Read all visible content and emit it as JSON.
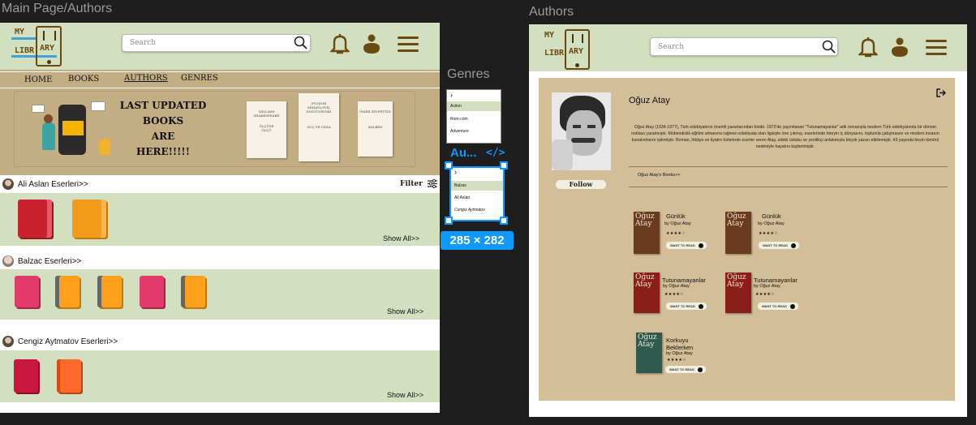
{
  "canvas": {
    "frame1_title": "Main Page/Authors",
    "frame2_title": "Authors",
    "component_title": "Genres",
    "component2_title": "Au...",
    "selection_size": "285 × 282",
    "code_icon_glyph": "</>"
  },
  "logo": {
    "line1": "MY",
    "line2": "LIBR",
    "line3": "ARY"
  },
  "header": {
    "search_placeholder": "Search"
  },
  "main": {
    "nav": [
      "HOME",
      "BOOKS",
      "AUTHORS",
      "GENRES"
    ],
    "banner_lines": [
      "LAST UPDATED",
      "BOOKS",
      "ARE",
      "HERE!!!!!"
    ],
    "banner_books": [
      {
        "lines": [
          "WILLIAM",
          "SHAKESPEARE",
          "",
          "",
          "",
          "",
          "",
          "",
          "",
          "",
          "",
          "ÖLÇÜYE",
          "ÖLÇÜ"
        ]
      },
      {
        "lines": [
          "FYODOR",
          "MİHAYLOVİÇ",
          "DOSTOYEVSKİ",
          "",
          "",
          "",
          "",
          "",
          "",
          "",
          "",
          "SUÇ VE CEZA"
        ]
      },
      {
        "lines": [
          "ÖMER SEYFETTİN",
          "",
          "",
          "",
          "",
          "",
          "",
          "",
          "",
          "",
          "",
          "KALBİM"
        ]
      }
    ],
    "sections": [
      {
        "label": "Ali Aslan Eserleri>>",
        "show_all": "Show All>>"
      },
      {
        "label": "Balzac  Eserleri>>",
        "show_all": "Show All>>"
      },
      {
        "label": "Cengiz Aytmatov Eserleri>>",
        "show_all": "Show All>>"
      }
    ],
    "filter_label": "Filter"
  },
  "genres": {
    "items": [
      "Action",
      "Rom-com",
      "Adventure"
    ],
    "items2": [
      "Balzac",
      "Ali Aslan",
      "Cengiz Aytmatov"
    ]
  },
  "author": {
    "name": "Oğuz Atay",
    "bio": "Oğuz Atay (1934-1977), Türk edebiyatının önemli yazarlarından biridir. 1972'de yayımlanan \"Tutunamayanlar\" adlı romanıyla modern Türk edebiyatında bir dönüm noktası yaratmıştır. Mühendislik eğitimi almasına rağmen edebiyata olan ilgisiyle öne çıkmış, eserlerinde bireyin iç dünyasını, toplumla çatışmasını ve modern insanın bunalımlarını işlemiştir. Roman, hikâye ve tiyatro türlerinde eserler veren Atay, edebi üslubu ve yenilikçi anlatımıyla birçok yazarı etkilemiştir. 43 yaşında beyin tümörü nedeniyle hayatını kaybetmiştir.",
    "follow_label": "Follow",
    "books_link": "Oğuz Atay's Books>>",
    "books": [
      {
        "title": "Günlük",
        "by": "by Oğuz Atay",
        "stars": "★★★★☆",
        "cta": "WANT TO READ",
        "cover_author": "Oğuz Atay",
        "cover_title": "Günlük",
        "color": "#6b3b1f"
      },
      {
        "title": "Günlük",
        "by": "by Oğuz Atay",
        "stars": "★★★★☆",
        "cta": "WANT TO READ",
        "cover_author": "Oğuz Atay",
        "cover_title": "Günlük",
        "color": "#6b3b1f"
      },
      {
        "title": "Tutunamayanlar",
        "by": "by Oğuz Atay",
        "stars": "★★★★☆",
        "cta": "WANT TO READ",
        "cover_author": "Oğuz Atay",
        "cover_title": "Tutunamayanlar",
        "color": "#8b1e1a"
      },
      {
        "title": "Tutunamayanlar",
        "by": "by Oğuz Atay",
        "stars": "★★★★☆",
        "cta": "WANT TO READ",
        "cover_author": "Oğuz Atay",
        "cover_title": "Tutunamayanlar",
        "color": "#8b1e1a"
      },
      {
        "title": "Korkuyu Beklerken",
        "by": "by Oğuz Atay",
        "stars": "★★★★☆",
        "cta": "WANT TO READ",
        "cover_author": "Oğuz Atay",
        "cover_title": "Korkuyu Beklerken",
        "color": "#2f5a4e"
      }
    ]
  },
  "colors": {
    "header_green": "#d2e0bf",
    "tan": "#c3ad82",
    "card_tan": "#d3be97",
    "brown_icon": "#6a4a10",
    "figma_blue": "#0d99ff"
  }
}
